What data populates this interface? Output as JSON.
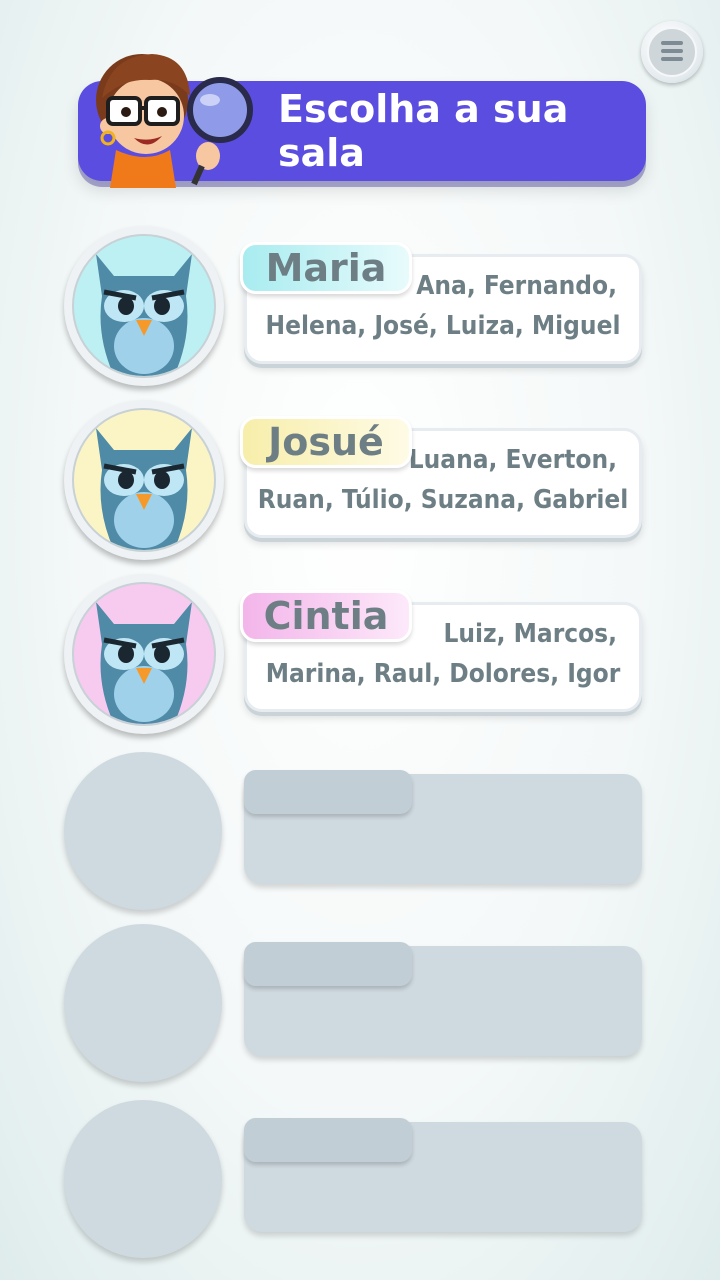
{
  "header": {
    "title": "Escolha a sua sala",
    "mascot_icon": "girl-with-magnifier-icon",
    "accent": "#5b4de0"
  },
  "menu": {
    "icon": "hamburger-menu-icon"
  },
  "classes": [
    {
      "teacher": "Maria",
      "line1": "Ana, Fernando,",
      "line2": "Helena, José, Luiza, Miguel",
      "color": "#bdf0f3",
      "avatar_icon": "owl-icon"
    },
    {
      "teacher": "Josué",
      "line1": "Luana, Everton,",
      "line2": "Ruan, Túlio, Suzana, Gabriel",
      "color": "#fbf5c6",
      "avatar_icon": "owl-icon"
    },
    {
      "teacher": "Cintia",
      "line1": "Luiz, Marcos,",
      "line2": "Marina, Raul, Dolores, Igor",
      "color": "#f7caf0",
      "avatar_icon": "owl-icon"
    }
  ],
  "empty_slots": 3
}
